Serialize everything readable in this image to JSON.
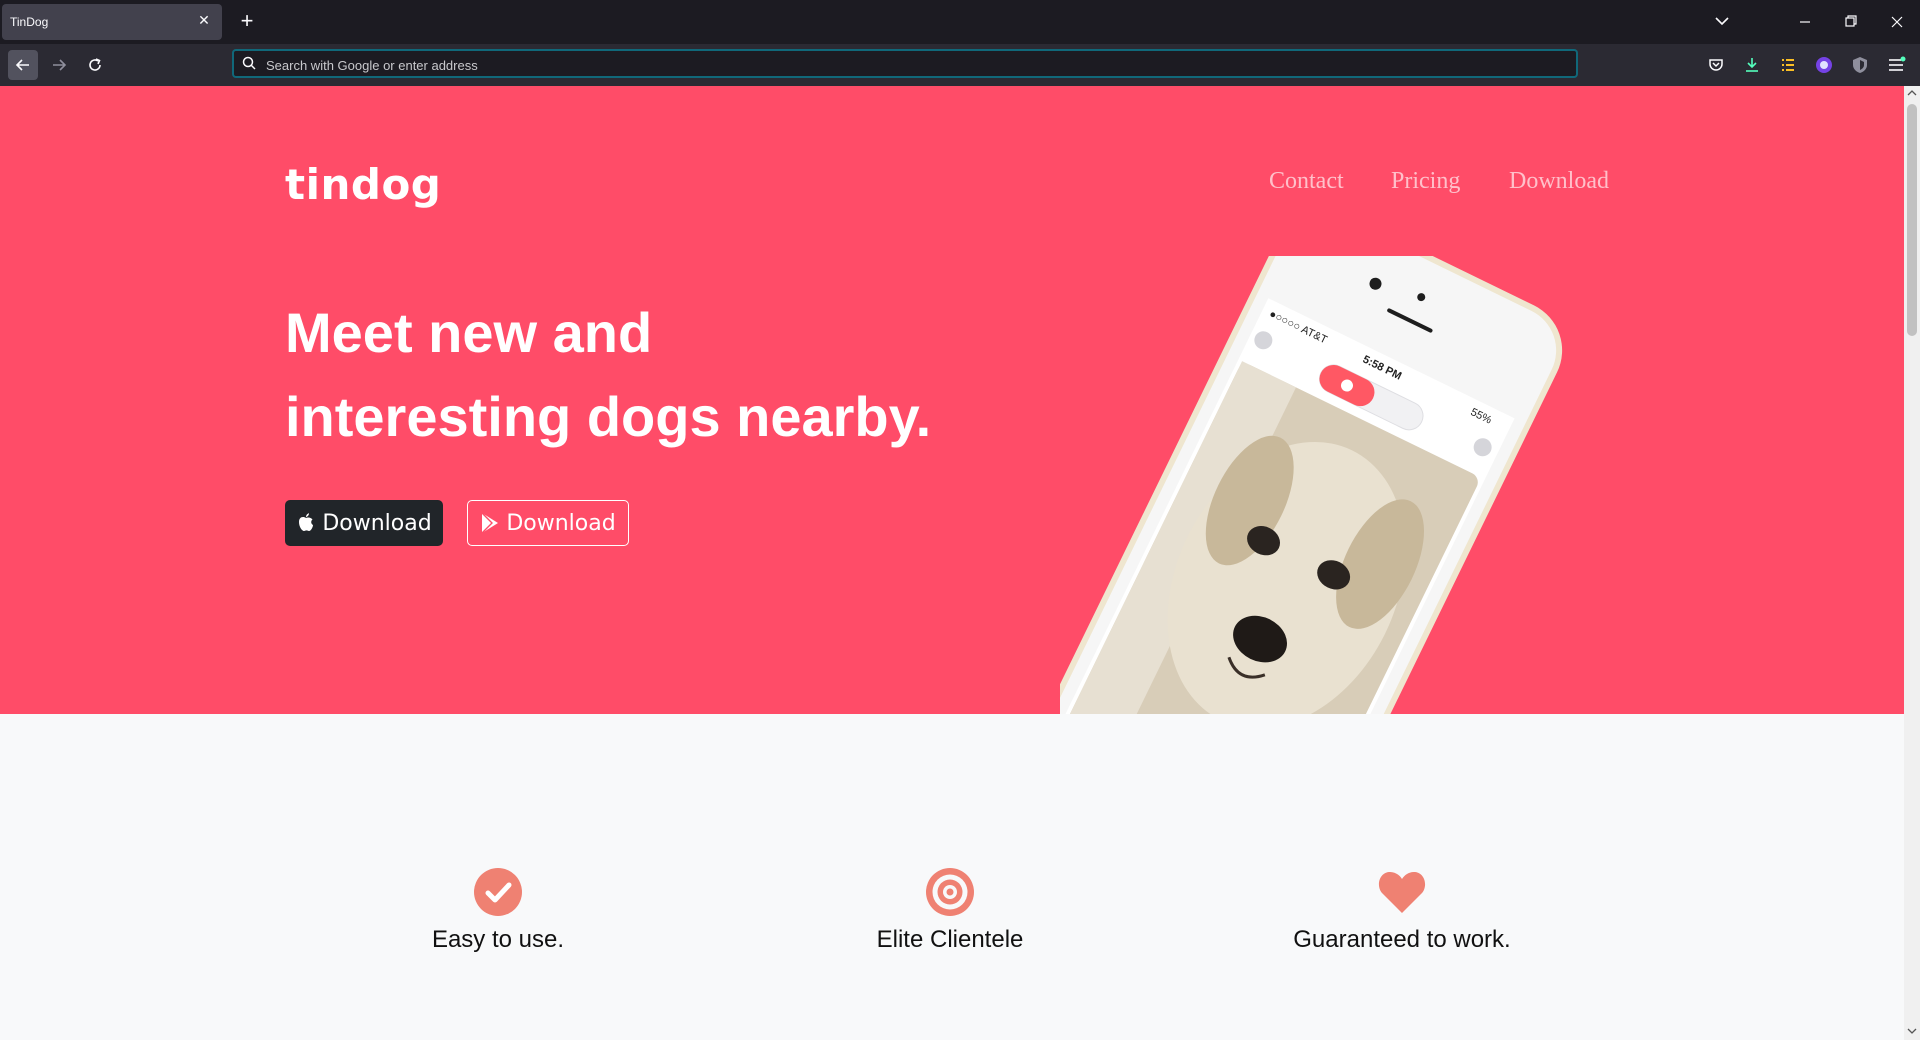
{
  "browser": {
    "tab_title": "TinDog",
    "tab_close": "✕",
    "new_tab": "+",
    "url_placeholder": "Search with Google or enter address",
    "url_value": ""
  },
  "page": {
    "brand": "tindog",
    "nav": [
      "Contact",
      "Pricing",
      "Download"
    ],
    "headline_line1": "Meet new and",
    "headline_line2": "interesting dogs nearby.",
    "apple_download_label": "Download",
    "google_download_label": "Download",
    "phone": {
      "carrier": "●○○○○ AT&T",
      "time": "5:58 PM",
      "battery": "55%"
    },
    "features": [
      {
        "title": "Easy to use.",
        "icon": "check-circle-icon"
      },
      {
        "title": "Elite Clientele",
        "icon": "bullseye-icon"
      },
      {
        "title": "Guaranteed to work.",
        "icon": "heart-icon"
      }
    ]
  },
  "colors": {
    "hero": "#ff4c68",
    "feature_icon": "#ef8172",
    "chrome_dark": "#1c1b22",
    "chrome_toolbar": "#2b2a33"
  }
}
